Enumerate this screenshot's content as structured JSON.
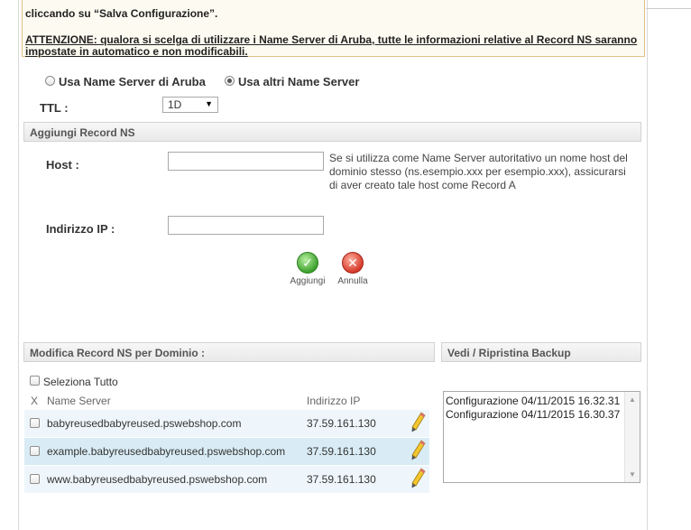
{
  "notice": {
    "line1": "cliccando su “Salva Configurazione”.",
    "warning": "ATTENZIONE: qualora si scelga di utilizzare i Name Server di Aruba, tutte le informazioni relative al Record NS saranno impostate in automatico e non modificabili."
  },
  "nameserver_mode": {
    "option_aruba": "Usa Name Server di Aruba",
    "option_other": "Usa altri Name Server",
    "selected": "Usa altri Name Server"
  },
  "ttl": {
    "label": "TTL :",
    "value": "1D"
  },
  "add_section": {
    "title": "Aggiungi Record NS",
    "host_label": "Host :",
    "host_value": "",
    "host_help": "Se si utilizza come Name Server autoritativo un nome host del dominio stesso (ns.esempio.xxx per esempio.xxx), assicurarsi di aver creato tale host come Record A",
    "ip_label": "Indirizzo IP :",
    "ip_value": "",
    "add_label": "Aggiungi",
    "cancel_label": "Annulla"
  },
  "modify_section": {
    "title": "Modifica Record NS per Dominio :",
    "select_all": "Seleziona Tutto",
    "columns": {
      "x": "X",
      "name": "Name Server",
      "ip": "Indirizzo IP"
    },
    "rows": [
      {
        "name": "babyreusedbabyreused.pswebshop.com",
        "ip": "37.59.161.130"
      },
      {
        "name": "example.babyreusedbabyreused.pswebshop.com",
        "ip": "37.59.161.130"
      },
      {
        "name": "www.babyreusedbabyreused.pswebshop.com",
        "ip": "37.59.161.130"
      }
    ]
  },
  "backup_section": {
    "title": "Vedi / Ripristina Backup",
    "items": [
      "Configurazione 04/11/2015 16.32.31",
      "Configurazione 04/11/2015 16.30.37"
    ]
  },
  "icons": {
    "add": "check-icon",
    "cancel": "x-icon",
    "edit": "pencil-icon"
  },
  "colors": {
    "notice_border": "#e2c08a",
    "row_highlight": "#d9ecf5",
    "row_light": "#eef6fb"
  }
}
